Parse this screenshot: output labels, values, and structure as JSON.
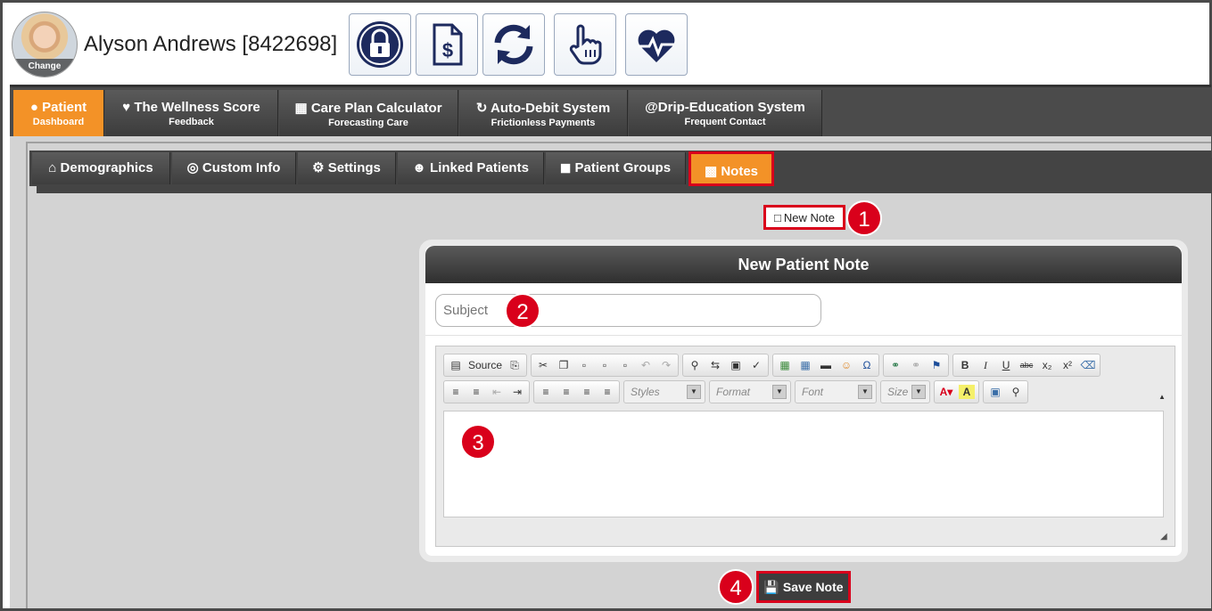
{
  "patient": {
    "name": "Alyson Andrews [8422698]",
    "avatar_change_label": "Change"
  },
  "header_buttons": [
    {
      "icon": "lock-icon"
    },
    {
      "icon": "invoice-dollar-icon"
    },
    {
      "icon": "sync-icon"
    },
    {
      "icon": "pointer-hand-icon"
    },
    {
      "icon": "heartbeat-icon"
    }
  ],
  "main_tabs": [
    {
      "label": "Patient",
      "sub": "Dashboard",
      "icon": "user-icon",
      "active": true
    },
    {
      "label": "The Wellness Score",
      "sub": "Feedback",
      "icon": "heart-icon"
    },
    {
      "label": "Care Plan Calculator",
      "sub": "Forecasting Care",
      "icon": "calculator-icon"
    },
    {
      "label": "Auto-Debit System",
      "sub": "Frictionless Payments",
      "icon": "refresh-icon"
    },
    {
      "label": "Drip-Education System",
      "sub": "Frequent Contact",
      "icon": "at-icon"
    }
  ],
  "sub_tabs": [
    {
      "label": "Demographics",
      "icon": "home-icon"
    },
    {
      "label": "Custom Info",
      "icon": "target-icon"
    },
    {
      "label": "Settings",
      "icon": "cog-icon"
    },
    {
      "label": "Linked Patients",
      "icon": "users-icon"
    },
    {
      "label": "Patient Groups",
      "icon": "bucket-icon"
    },
    {
      "label": "Notes",
      "icon": "note-icon",
      "active": true
    }
  ],
  "new_note_label": "New Note",
  "panel": {
    "title": "New Patient Note",
    "subject_placeholder": "Subject"
  },
  "editor": {
    "source_label": "Source",
    "styles_label": "Styles",
    "format_label": "Format",
    "font_label": "Font",
    "size_label": "Size"
  },
  "save_label": "Save Note",
  "callouts": [
    "1",
    "2",
    "3",
    "4"
  ],
  "colors": {
    "accent_orange": "#f39227",
    "highlight_red": "#d9001b",
    "nav_dark": "#444444",
    "icon_navy": "#1d2a5e"
  }
}
